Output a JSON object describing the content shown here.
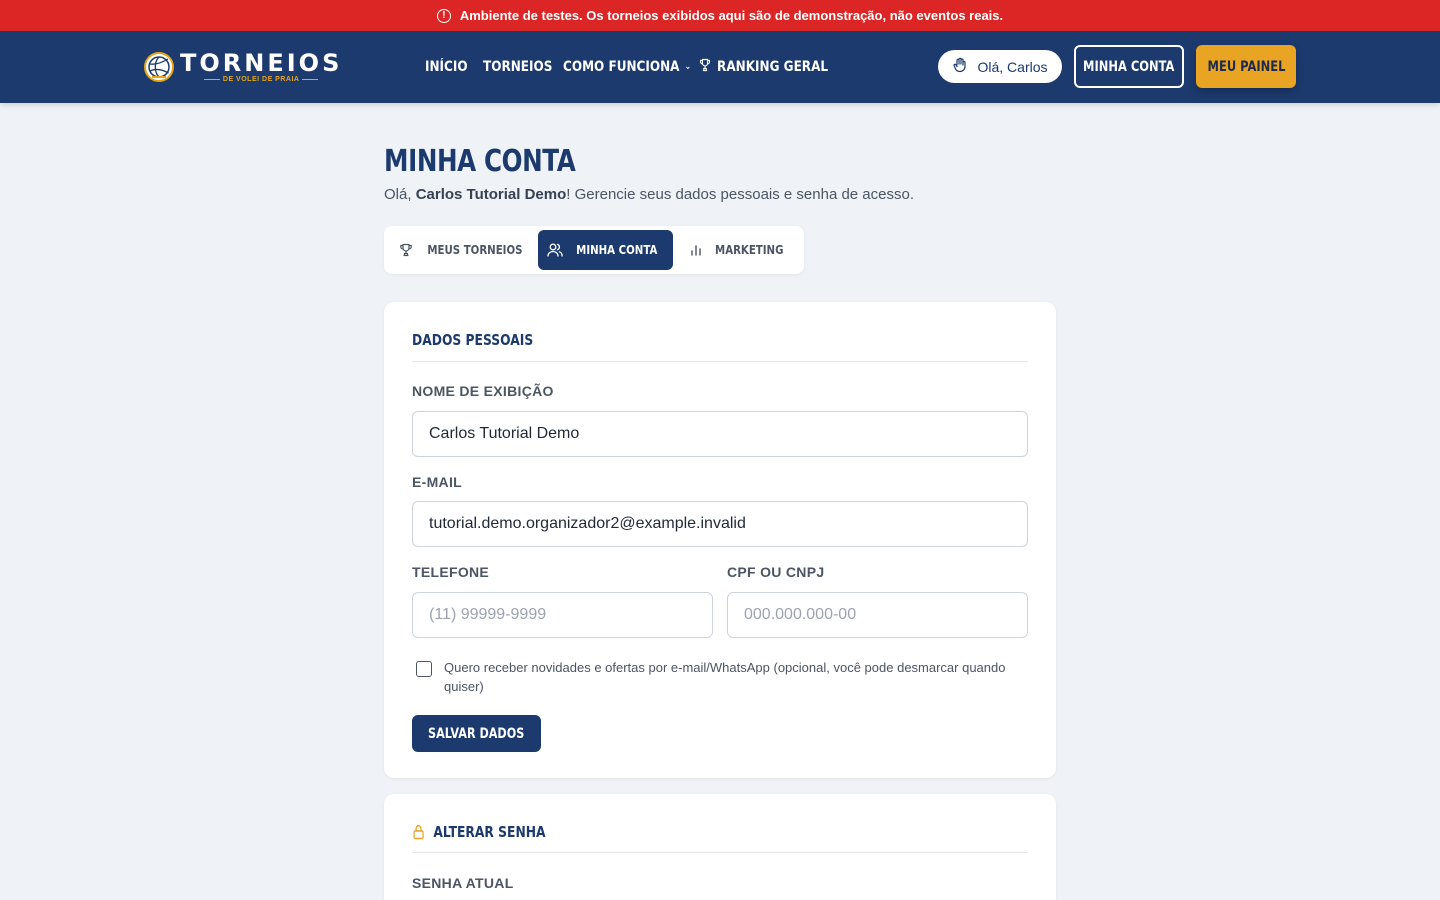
{
  "banner": {
    "icon": "alert-circle-icon",
    "text": "Ambiente de testes. Os torneios exibidos aqui são de demonstração, não eventos reais.",
    "color": "#dc2626"
  },
  "brand": {
    "title": "TORNEIOS",
    "subtitle": "DE VOLEI DE PRAIA",
    "nav_color": "#1c3a6e",
    "accent": "#e8a422"
  },
  "nav": {
    "inicio": "INÍCIO",
    "torneios": "TORNEIOS",
    "como_funciona": "COMO FUNCIONA",
    "ranking": "RANKING GERAL"
  },
  "header": {
    "greeting": "Olá, Carlos",
    "account_button": "MINHA CONTA",
    "panel_button": "MEU PAINEL"
  },
  "page": {
    "title": "MINHA CONTA",
    "subtitle_prefix": "Olá, ",
    "user_name": "Carlos Tutorial Demo",
    "subtitle_suffix": "! Gerencie seus dados pessoais e senha de acesso."
  },
  "tabs": [
    {
      "label": "MEUS TORNEIOS",
      "icon": "trophy-icon",
      "active": false
    },
    {
      "label": "MINHA CONTA",
      "icon": "users-icon",
      "active": true
    },
    {
      "label": "MARKETING",
      "icon": "bar-chart-icon",
      "active": false
    }
  ],
  "personal": {
    "section_title": "DADOS PESSOAIS",
    "name_label": "NOME DE EXIBIÇÃO",
    "name_value": "Carlos Tutorial Demo",
    "email_label": "E-MAIL",
    "email_value": "tutorial.demo.organizador2@example.invalid",
    "phone_label": "TELEFONE",
    "phone_placeholder": "(11) 99999-9999",
    "doc_label": "CPF OU CNPJ",
    "doc_placeholder": "000.000.000-00",
    "newsletter_text": "Quero receber novidades e ofertas por e-mail/WhatsApp (opcional, você pode desmarcar quando quiser)",
    "newsletter_checked": false,
    "save_button": "SALVAR DADOS"
  },
  "password": {
    "section_title": "ALTERAR SENHA",
    "icon": "lock-icon",
    "current_label": "SENHA ATUAL"
  }
}
